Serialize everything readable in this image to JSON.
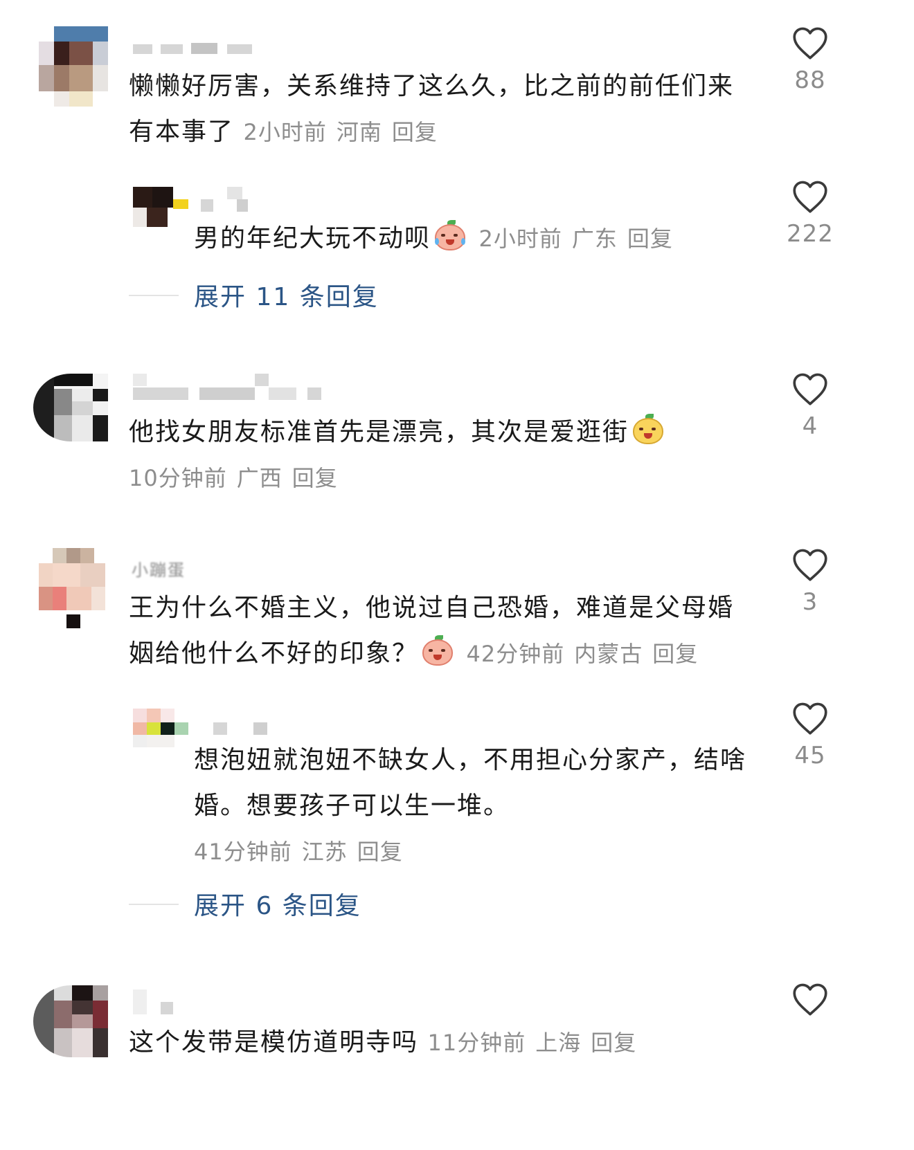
{
  "comments": [
    {
      "username": "",
      "text": "懒懒好厉害，关系维持了这么久，比之前的前任们来有本事了",
      "time": "2小时前",
      "location": "河南",
      "reply_label": "回复",
      "likes": "88"
    },
    {
      "username": "",
      "text": "男的年纪大玩不动呗",
      "emoji": "cry-laugh-emoji",
      "time": "2小时前",
      "location": "广东",
      "reply_label": "回复",
      "likes": "222"
    },
    {
      "username": "",
      "text": "他找女朋友标准首先是漂亮，其次是爱逛街",
      "emoji": "curious-emoji",
      "time": "10分钟前",
      "location": "广西",
      "reply_label": "回复",
      "likes": "4"
    },
    {
      "username": "小蹦蛋",
      "text": "王为什么不婚主义，他说过自己恐婚，难道是父母婚姻给他什么不好的印象？",
      "emoji": "shy-emoji",
      "time": "42分钟前",
      "location": "内蒙古",
      "reply_label": "回复",
      "likes": "3"
    },
    {
      "username": "",
      "text": "想泡妞就泡妞不缺女人，不用担心分家产，结啥婚。想要孩子可以生一堆。",
      "time": "41分钟前",
      "location": "江苏",
      "reply_label": "回复",
      "likes": "45"
    },
    {
      "username": "",
      "text": "这个发带是模仿道明寺吗",
      "time": "11分钟前",
      "location": "上海",
      "reply_label": "回复",
      "likes": ""
    }
  ],
  "expand_replies": [
    "展开 11 条回复",
    "展开 6 条回复"
  ],
  "colors": {
    "text": "#1a1a1a",
    "meta": "#8d8d8d",
    "expand": "#2b5586",
    "heart": "#3a3a3a"
  }
}
